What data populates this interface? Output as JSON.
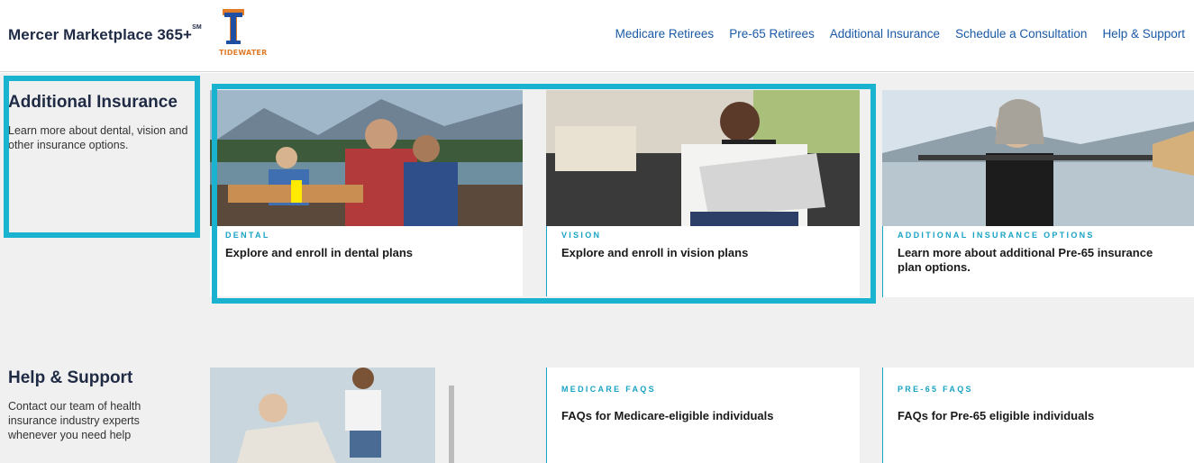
{
  "header": {
    "brand": "Mercer Marketplace 365+",
    "brand_mark": "SM",
    "logo_text": "TIDEWATER",
    "nav": [
      {
        "label": "Medicare Retirees"
      },
      {
        "label": "Pre-65 Retirees"
      },
      {
        "label": "Additional Insurance"
      },
      {
        "label": "Schedule a Consultation"
      },
      {
        "label": "Help & Support"
      }
    ]
  },
  "additional": {
    "title": "Additional Insurance",
    "desc": "Learn more about dental, vision and other insurance options.",
    "cards": [
      {
        "category": "DENTAL",
        "cta": "Explore and enroll in dental plans"
      },
      {
        "category": "VISION",
        "cta": "Explore and enroll in vision plans"
      },
      {
        "category": "ADDITIONAL INSURANCE OPTIONS",
        "cta": "Learn more about additional Pre-65 insurance plan options."
      }
    ]
  },
  "help": {
    "title": "Help & Support",
    "desc": "Contact our team of health insurance industry experts whenever you need help",
    "cards": [
      {
        "category": "MEDICARE FAQS",
        "cta": "FAQs for Medicare-eligible individuals"
      },
      {
        "category": "PRE-65 FAQS",
        "cta": "FAQs for Pre-65 eligible individuals"
      }
    ]
  },
  "colors": {
    "accent": "#19b3cf",
    "brand_navy": "#1f2a44",
    "nav_link": "#1a5aa6",
    "logo_orange": "#e07b2a",
    "logo_blue": "#1f4fa3"
  }
}
